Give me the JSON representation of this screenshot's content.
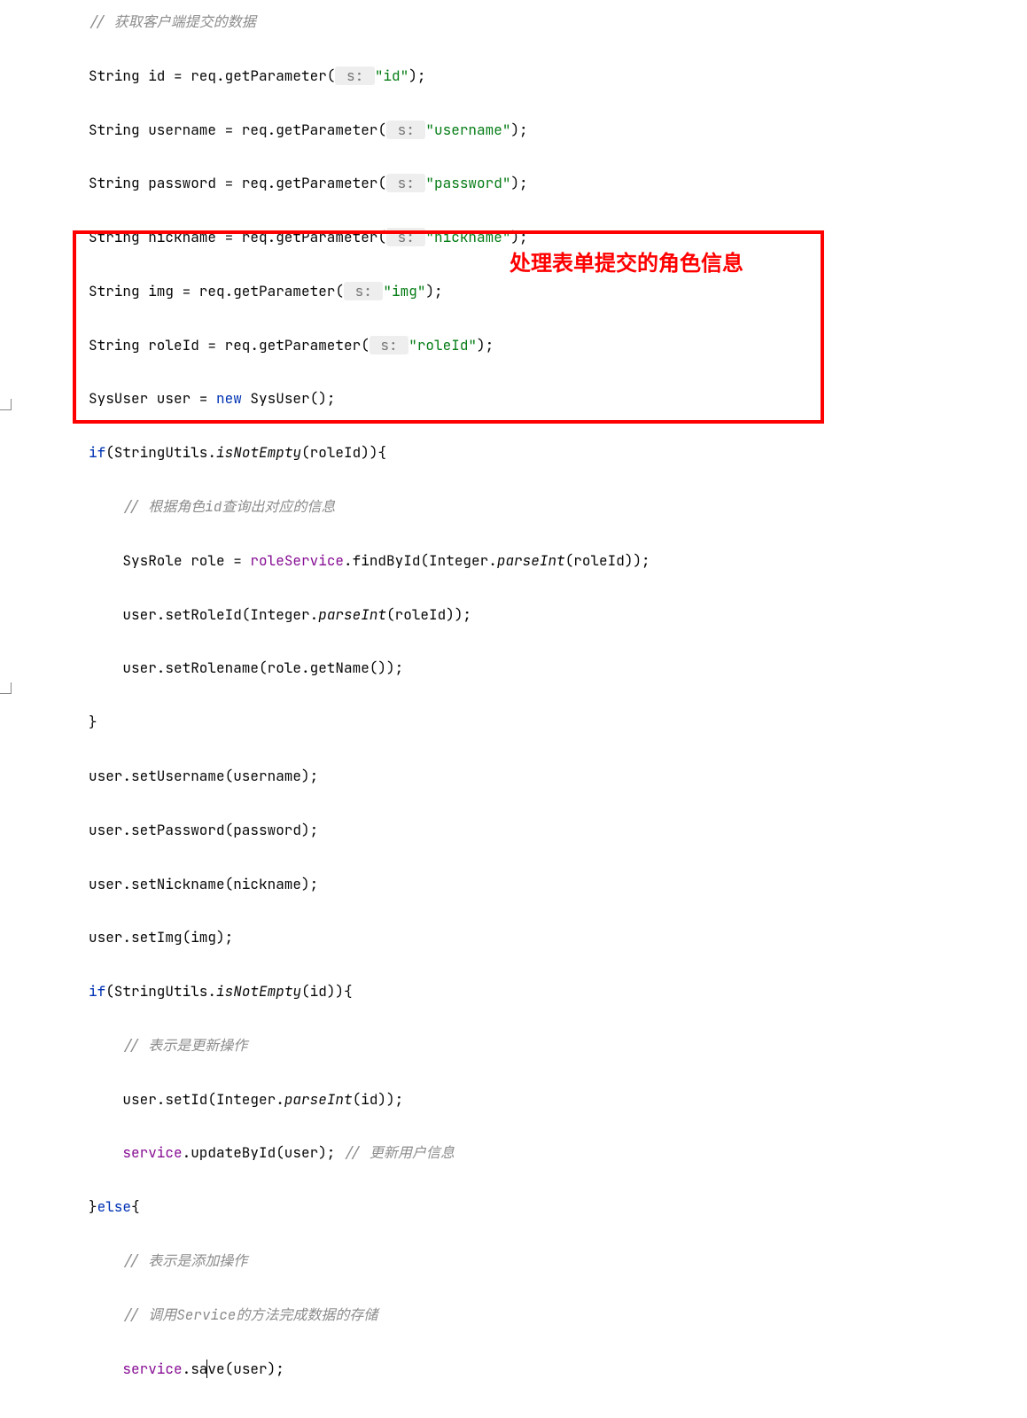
{
  "code": {
    "c1": "// 获取客户端提交的数据",
    "l2a": "String id = req.getParameter(",
    "l2h": " s: ",
    "l2s": "\"id\"",
    "l2e": ");",
    "l3a": "String username = req.getParameter(",
    "l3h": " s: ",
    "l3s": "\"username\"",
    "l3e": ");",
    "l4a": "String password = req.getParameter(",
    "l4h": " s: ",
    "l4s": "\"password\"",
    "l4e": ");",
    "l5a": "String nickname = req.getParameter(",
    "l5h": " s: ",
    "l5s": "\"nickname\"",
    "l5e": ");",
    "l6a": "String img = req.getParameter(",
    "l6h": " s: ",
    "l6s": "\"img\"",
    "l6e": ");",
    "l7a": "String roleId = req.getParameter(",
    "l7h": " s: ",
    "l7s": "\"roleId\"",
    "l7e": ");",
    "l8a": "SysUser user = ",
    "l8kw": "new",
    "l8b": " SysUser();",
    "l9kw": "if",
    "l9a": "(StringUtils.",
    "l9fn": "isNotEmpty",
    "l9b": "(roleId)){",
    "c10": "// 根据角色id查询出对应的信息",
    "l11a": "SysRole role = ",
    "l11f": "roleService",
    "l11b": ".findById(Integer.",
    "l11fn": "parseInt",
    "l11c": "(roleId));",
    "l12a": "user.setRoleId(Integer.",
    "l12fn": "parseInt",
    "l12b": "(roleId));",
    "l13": "user.setRolename(role.getName());",
    "l14": "}",
    "l15": "user.setUsername(username);",
    "l16": "user.setPassword(password);",
    "l17": "user.setNickname(nickname);",
    "l18": "user.setImg(img);",
    "l19kw": "if",
    "l19a": "(StringUtils.",
    "l19fn": "isNotEmpty",
    "l19b": "(id)){",
    "c20": "// 表示是更新操作",
    "l21a": "user.setId(Integer.",
    "l21fn": "parseInt",
    "l21b": "(id));",
    "l22f": "service",
    "l22a": ".updateById(user); ",
    "c22": "// 更新用户信息",
    "l23a": "}",
    "l23kw": "else",
    "l23b": "{",
    "c24": "// 表示是添加操作",
    "c25": "// 调用Service的方法完成数据的存储",
    "l26f": "service",
    "l26a": ".sa",
    "l26b": "ve(user);"
  },
  "annotation": "处理表单提交的角色信息"
}
